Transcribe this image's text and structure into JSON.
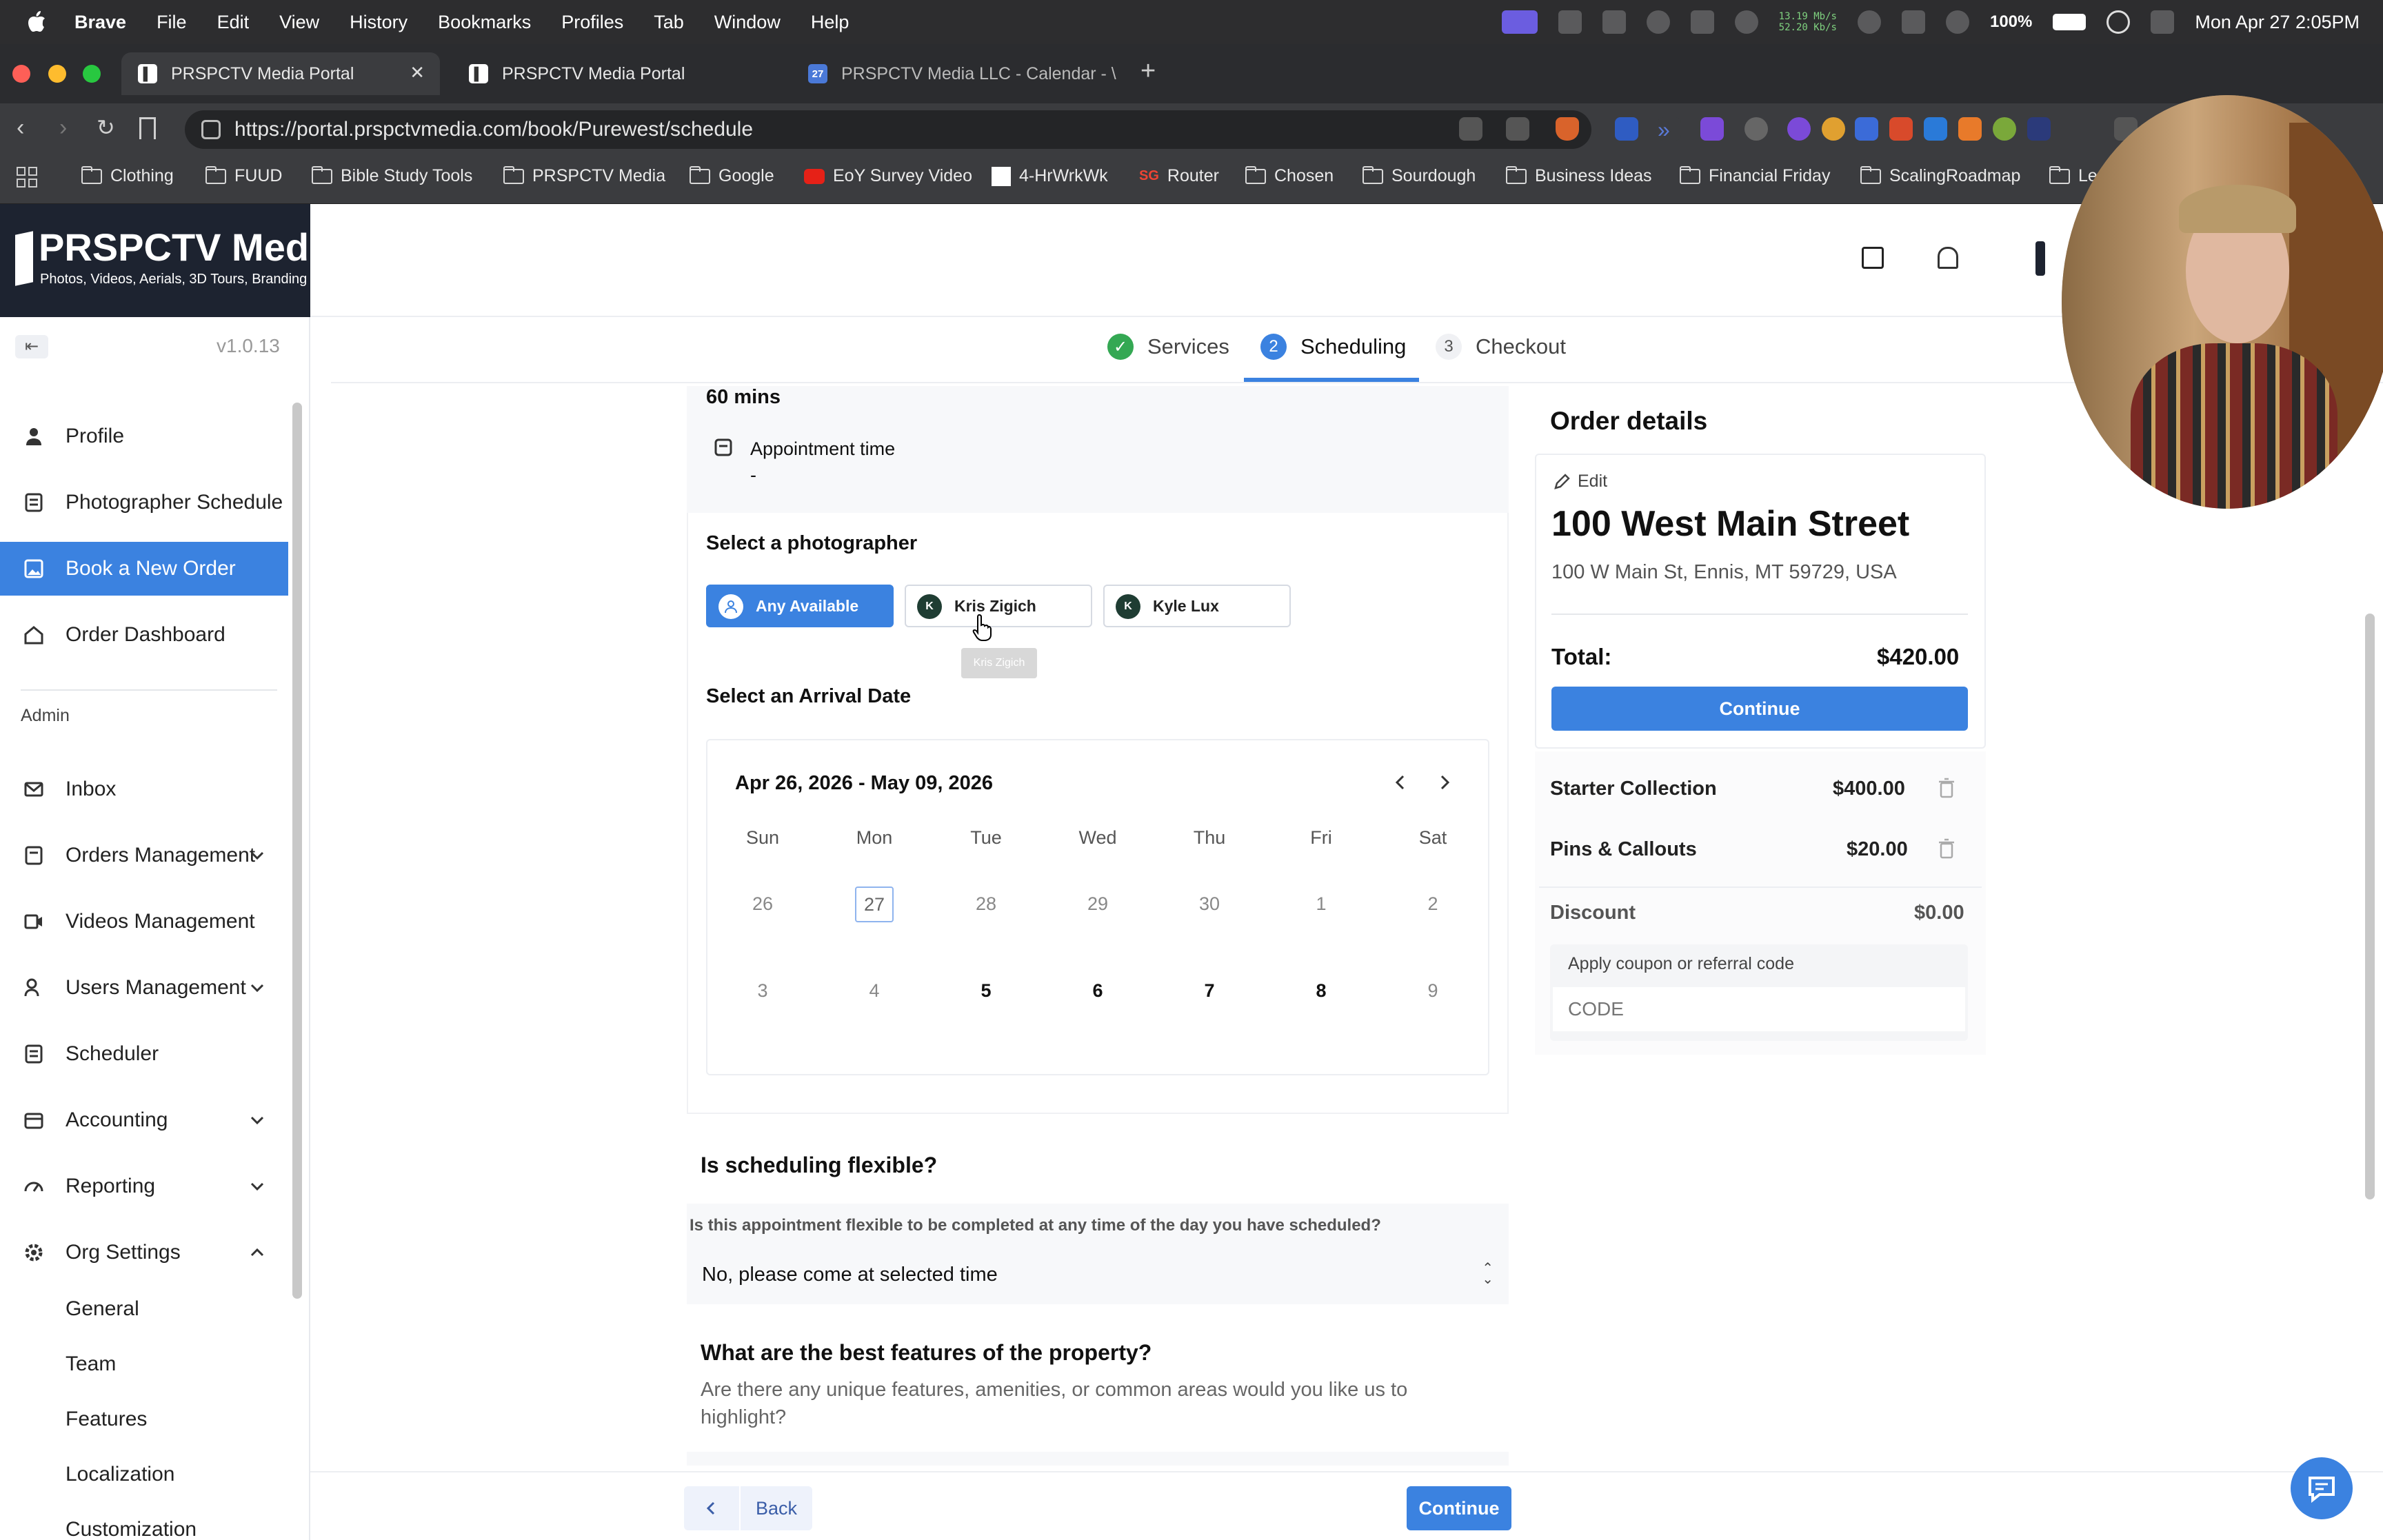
{
  "menubar": {
    "app": "Brave",
    "items": [
      "File",
      "Edit",
      "View",
      "History",
      "Bookmarks",
      "Profiles",
      "Tab",
      "Window",
      "Help"
    ],
    "net_up": "13.19 Mb/s",
    "net_down": "52.20 Kb/s",
    "battery": "100%",
    "datetime": "Mon Apr 27  2:05PM"
  },
  "tabs": [
    {
      "title": "PRSPCTV Media Portal"
    },
    {
      "title": "PRSPCTV Media Portal"
    },
    {
      "title": "PRSPCTV Media LLC - Calendar - \\",
      "icon_text": "27"
    }
  ],
  "address": {
    "url": "https://portal.prspctvmedia.com/book/Purewest/schedule"
  },
  "bookmarks": [
    "Clothing",
    "FUUD",
    "Bible Study Tools",
    "PRSPCTV Media",
    "Google",
    "EoY Survey Video",
    "4-HrWrkWk",
    "Router",
    "Chosen",
    "Sourdough",
    "Business Ideas",
    "Financial Friday",
    "ScalingRoadmap",
    "Le"
  ],
  "brand": {
    "name": "PRSPCTV Media",
    "tagline": "Photos, Videos, Aerials, 3D Tours, Branding"
  },
  "sidebar": {
    "version": "v1.0.13",
    "items": [
      {
        "label": "Profile"
      },
      {
        "label": "Photographer Schedule"
      },
      {
        "label": "Book a New Order"
      },
      {
        "label": "Order Dashboard"
      }
    ],
    "admin_label": "Admin",
    "admin_items": [
      {
        "label": "Inbox"
      },
      {
        "label": "Orders Management"
      },
      {
        "label": "Videos Management"
      },
      {
        "label": "Users Management"
      },
      {
        "label": "Scheduler"
      },
      {
        "label": "Accounting"
      },
      {
        "label": "Reporting"
      },
      {
        "label": "Org Settings"
      }
    ],
    "sub_items": [
      "General",
      "Team",
      "Features",
      "Localization",
      "Customization"
    ]
  },
  "stepper": {
    "steps": [
      {
        "num": "",
        "label": "Services"
      },
      {
        "num": "2",
        "label": "Scheduling"
      },
      {
        "num": "3",
        "label": "Checkout"
      }
    ]
  },
  "duration": "60 mins",
  "appointment": {
    "label": "Appointment time",
    "value": "-"
  },
  "photographer": {
    "title": "Select a photographer",
    "options": [
      {
        "initial": "",
        "name": "Any Available"
      },
      {
        "initial": "K",
        "name": "Kris Zigich"
      },
      {
        "initial": "K",
        "name": "Kyle Lux"
      }
    ],
    "tooltip": "Kris Zigich"
  },
  "calendar": {
    "title": "Select an Arrival Date",
    "range": "Apr 26, 2026 - May 09, 2026",
    "weekdays": [
      "Sun",
      "Mon",
      "Tue",
      "Wed",
      "Thu",
      "Fri",
      "Sat"
    ],
    "weeks": [
      [
        "26",
        "27",
        "28",
        "29",
        "30",
        "1",
        "2"
      ],
      [
        "3",
        "4",
        "5",
        "6",
        "7",
        "8",
        "9"
      ]
    ]
  },
  "flexible": {
    "title": "Is scheduling flexible?",
    "question": "Is this appointment flexible to be completed at any time of the day you have scheduled?",
    "value": "No, please come at selected time"
  },
  "features": {
    "title": "What are the best features of the property?",
    "description": "Are there any unique features, amenities, or common areas would you like us to highlight?"
  },
  "footer": {
    "back": "Back",
    "continue": "Continue"
  },
  "order": {
    "title": "Order details",
    "edit": "Edit",
    "address_title": "100 West Main Street",
    "address_full": "100 W Main St, Ennis, MT 59729, USA",
    "total_label": "Total:",
    "total_value": "$420.00",
    "continue": "Continue",
    "items": [
      {
        "name": "Starter Collection",
        "price": "$400.00"
      },
      {
        "name": "Pins & Callouts",
        "price": "$20.00"
      }
    ],
    "discount_label": "Discount",
    "discount_value": "$0.00",
    "coupon_label": "Apply coupon or referral code",
    "coupon_placeholder": "CODE"
  },
  "colors": {
    "accent": "#3b82e0",
    "sidebar_logo_bg": "#1d2330",
    "success": "#34a853"
  }
}
